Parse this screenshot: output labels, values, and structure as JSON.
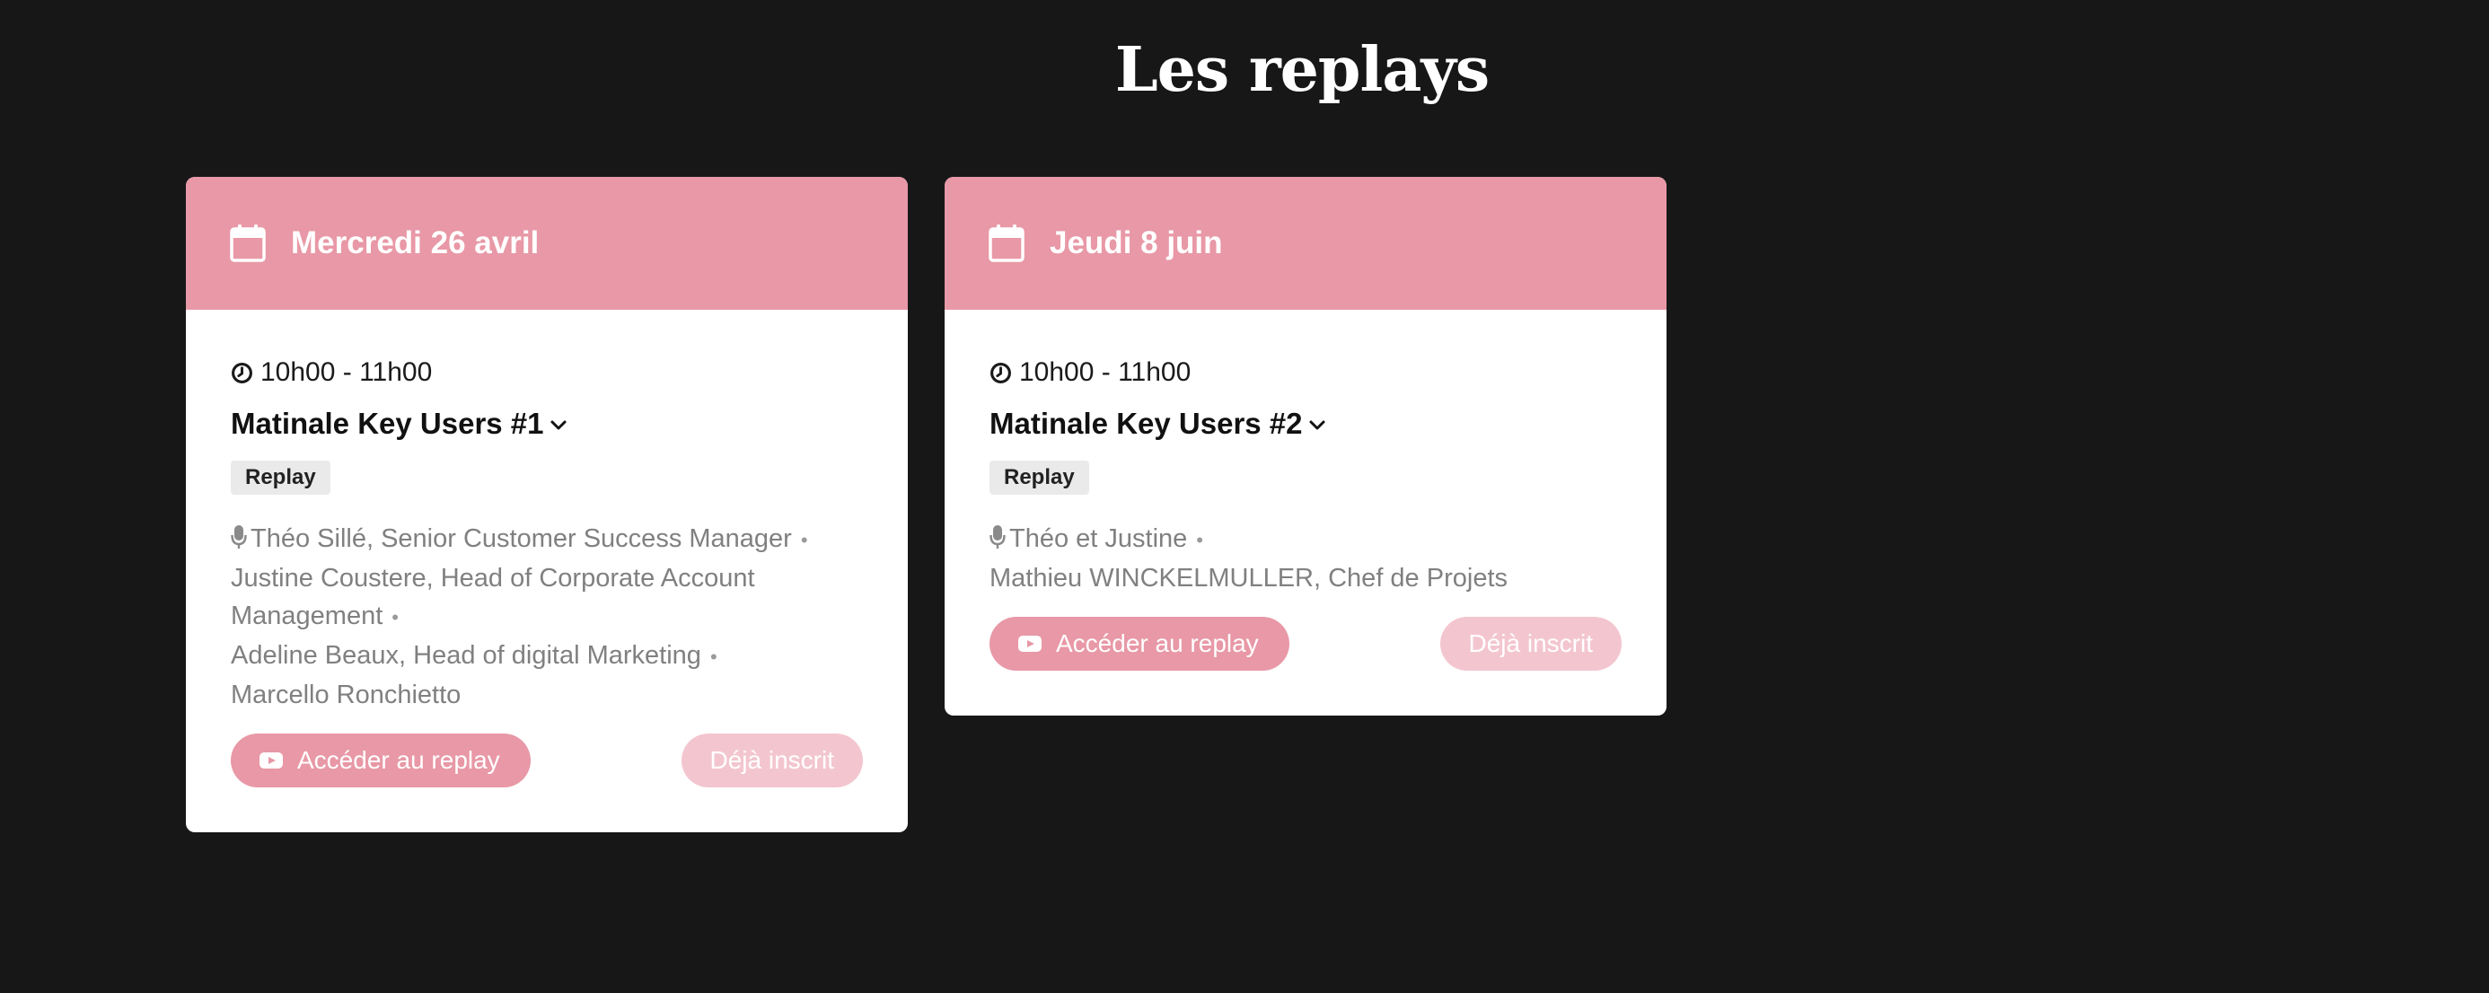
{
  "section": {
    "title": "Les replays"
  },
  "colors": {
    "accent": "#e898a6",
    "accent_light": "#f3c6cf",
    "background": "#171717"
  },
  "cards": [
    {
      "date": "Mercredi 26 avril",
      "time": "10h00 - 11h00",
      "title": "Matinale Key Users #1",
      "badge": "Replay",
      "speakers": [
        "Théo Sillé, Senior Customer Success Manager",
        "Justine Coustere, Head of Corporate Account Management",
        "Adeline Beaux, Head of digital Marketing",
        "Marcello Ronchietto"
      ],
      "replay_label": "Accéder au replay",
      "registered_label": "Déjà inscrit"
    },
    {
      "date": "Jeudi 8 juin",
      "time": "10h00 - 11h00",
      "title": "Matinale Key Users #2",
      "badge": "Replay",
      "speakers": [
        "Théo et Justine",
        "Mathieu WINCKELMULLER, Chef de Projets"
      ],
      "replay_label": "Accéder au replay",
      "registered_label": "Déjà inscrit"
    }
  ],
  "icons": {
    "calendar": "calendar-icon",
    "clock": "clock-icon",
    "chevron": "chevron-down-icon",
    "microphone": "microphone-icon",
    "video": "youtube-icon"
  }
}
